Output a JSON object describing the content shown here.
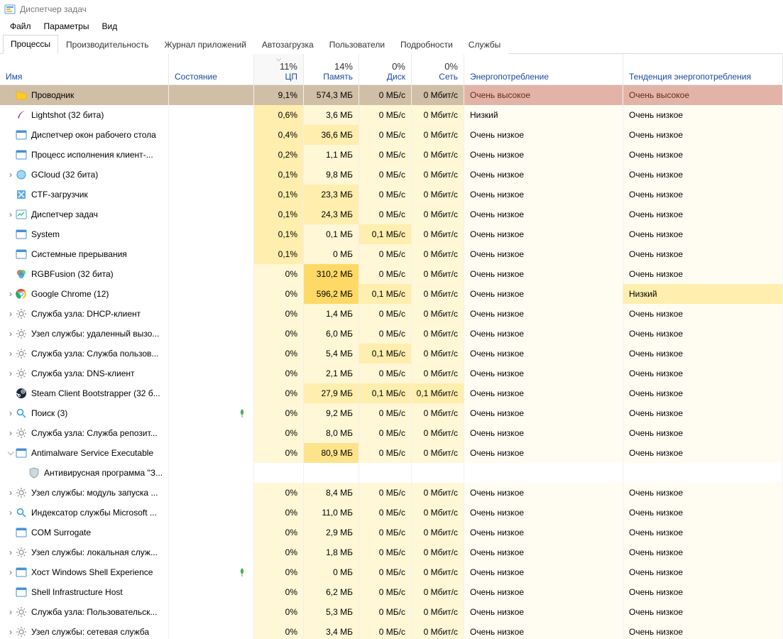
{
  "window": {
    "title": "Диспетчер задач"
  },
  "menu": {
    "file": "Файл",
    "options": "Параметры",
    "view": "Вид"
  },
  "tabs": [
    {
      "id": "processes",
      "label": "Процессы",
      "active": true
    },
    {
      "id": "performance",
      "label": "Производительность"
    },
    {
      "id": "app-history",
      "label": "Журнал приложений"
    },
    {
      "id": "startup",
      "label": "Автозагрузка"
    },
    {
      "id": "users",
      "label": "Пользователи"
    },
    {
      "id": "details",
      "label": "Подробности"
    },
    {
      "id": "services",
      "label": "Службы"
    }
  ],
  "columns": {
    "name": {
      "label": "Имя"
    },
    "status": {
      "label": "Состояние"
    },
    "cpu": {
      "label": "ЦП",
      "summary": "11%",
      "sorted": "desc"
    },
    "mem": {
      "label": "Память",
      "summary": "14%"
    },
    "disk": {
      "label": "Диск",
      "summary": "0%"
    },
    "net": {
      "label": "Сеть",
      "summary": "0%"
    },
    "power": {
      "label": "Энергопотребление"
    },
    "trend": {
      "label": "Тенденция энергопотребления"
    }
  },
  "processes": [
    {
      "name": "Проводник",
      "icon": "folder",
      "cpu": "9,1%",
      "mem": "574,3 МБ",
      "disk": "0 МБ/с",
      "net": "0 Мбит/с",
      "power": "Очень высокое",
      "trend": "Очень высокое",
      "selected": true,
      "cpuHeat": 3,
      "memHeat": 3
    },
    {
      "name": "Lightshot (32 бита)",
      "icon": "feather",
      "cpu": "0,6%",
      "mem": "3,6 МБ",
      "disk": "0 МБ/с",
      "net": "0 Мбит/с",
      "power": "Низкий",
      "trend": "Очень низкое",
      "cpuHeat": 1,
      "memHeat": 0
    },
    {
      "name": "Диспетчер окон рабочего стола",
      "icon": "winexe",
      "cpu": "0,4%",
      "mem": "36,6 МБ",
      "disk": "0 МБ/с",
      "net": "0 Мбит/с",
      "power": "Очень низкое",
      "trend": "Очень низкое",
      "cpuHeat": 1,
      "memHeat": 1
    },
    {
      "name": "Процесс исполнения клиент-...",
      "icon": "winexe",
      "cpu": "0,2%",
      "mem": "1,1 МБ",
      "disk": "0 МБ/с",
      "net": "0 Мбит/с",
      "power": "Очень низкое",
      "trend": "Очень низкое",
      "cpuHeat": 1,
      "memHeat": 0
    },
    {
      "name": "GCloud (32 бита)",
      "icon": "gcloud",
      "expand": ">",
      "cpu": "0,1%",
      "mem": "9,8 МБ",
      "disk": "0 МБ/с",
      "net": "0 Мбит/с",
      "power": "Очень низкое",
      "trend": "Очень низкое",
      "cpuHeat": 1,
      "memHeat": 0
    },
    {
      "name": "CTF-загрузчик",
      "icon": "ctf",
      "cpu": "0,1%",
      "mem": "23,3 МБ",
      "disk": "0 МБ/с",
      "net": "0 Мбит/с",
      "power": "Очень низкое",
      "trend": "Очень низкое",
      "cpuHeat": 1,
      "memHeat": 1
    },
    {
      "name": "Диспетчер задач",
      "icon": "taskmgr",
      "expand": ">",
      "cpu": "0,1%",
      "mem": "24,3 МБ",
      "disk": "0 МБ/с",
      "net": "0 Мбит/с",
      "power": "Очень низкое",
      "trend": "Очень низкое",
      "cpuHeat": 1,
      "memHeat": 1
    },
    {
      "name": "System",
      "icon": "winexe",
      "cpu": "0,1%",
      "mem": "0,1 МБ",
      "disk": "0,1 МБ/с",
      "net": "0 Мбит/с",
      "power": "Очень низкое",
      "trend": "Очень низкое",
      "cpuHeat": 1,
      "memHeat": 0,
      "diskHeat": 1
    },
    {
      "name": "Системные прерывания",
      "icon": "winexe",
      "cpu": "0,1%",
      "mem": "0 МБ",
      "disk": "0 МБ/с",
      "net": "0 Мбит/с",
      "power": "Очень низкое",
      "trend": "Очень низкое",
      "cpuHeat": 1,
      "memHeat": 0
    },
    {
      "name": "RGBFusion (32 бита)",
      "icon": "rgb",
      "cpu": "0%",
      "mem": "310,2 МБ",
      "disk": "0 МБ/с",
      "net": "0 Мбит/с",
      "power": "Очень низкое",
      "trend": "Очень низкое",
      "cpuHeat": 0,
      "memHeat": 3
    },
    {
      "name": "Google Chrome (12)",
      "icon": "chrome",
      "expand": ">",
      "cpu": "0%",
      "mem": "596,2 МБ",
      "disk": "0,1 МБ/с",
      "net": "0 Мбит/с",
      "power": "Очень низкое",
      "trend": "Низкий",
      "trendHeat": 1,
      "cpuHeat": 0,
      "memHeat": 3,
      "diskHeat": 1
    },
    {
      "name": "Служба узла: DHCP-клиент",
      "icon": "gear",
      "expand": ">",
      "cpu": "0%",
      "mem": "1,4 МБ",
      "disk": "0 МБ/с",
      "net": "0 Мбит/с",
      "power": "Очень низкое",
      "trend": "Очень низкое",
      "cpuHeat": 0,
      "memHeat": 0
    },
    {
      "name": "Узел службы: удаленный вызо...",
      "icon": "gear",
      "expand": ">",
      "cpu": "0%",
      "mem": "6,0 МБ",
      "disk": "0 МБ/с",
      "net": "0 Мбит/с",
      "power": "Очень низкое",
      "trend": "Очень низкое",
      "cpuHeat": 0,
      "memHeat": 0
    },
    {
      "name": "Служба узла: Служба пользов...",
      "icon": "gear",
      "expand": ">",
      "cpu": "0%",
      "mem": "5,4 МБ",
      "disk": "0,1 МБ/с",
      "net": "0 Мбит/с",
      "power": "Очень низкое",
      "trend": "Очень низкое",
      "cpuHeat": 0,
      "memHeat": 0,
      "diskHeat": 1
    },
    {
      "name": "Служба узла: DNS-клиент",
      "icon": "gear",
      "expand": ">",
      "cpu": "0%",
      "mem": "2,1 МБ",
      "disk": "0 МБ/с",
      "net": "0 Мбит/с",
      "power": "Очень низкое",
      "trend": "Очень низкое",
      "cpuHeat": 0,
      "memHeat": 0
    },
    {
      "name": "Steam Client Bootstrapper (32 б...",
      "icon": "steam",
      "cpu": "0%",
      "mem": "27,9 МБ",
      "disk": "0,1 МБ/с",
      "net": "0,1 Мбит/с",
      "power": "Очень низкое",
      "trend": "Очень низкое",
      "cpuHeat": 0,
      "memHeat": 1,
      "diskHeat": 1,
      "netHeat": 1
    },
    {
      "name": "Поиск (3)",
      "icon": "search",
      "expand": ">",
      "leaf": true,
      "cpu": "0%",
      "mem": "9,2 МБ",
      "disk": "0 МБ/с",
      "net": "0 Мбит/с",
      "power": "Очень низкое",
      "trend": "Очень низкое",
      "cpuHeat": 0,
      "memHeat": 0
    },
    {
      "name": "Служба узла: Служба репозит...",
      "icon": "gear",
      "expand": ">",
      "cpu": "0%",
      "mem": "8,0 МБ",
      "disk": "0 МБ/с",
      "net": "0 Мбит/с",
      "power": "Очень низкое",
      "trend": "Очень низкое",
      "cpuHeat": 0,
      "memHeat": 0
    },
    {
      "name": "Antimalware Service Executable",
      "icon": "winexe",
      "expand": "v",
      "cpu": "0%",
      "mem": "80,9 МБ",
      "disk": "0 МБ/с",
      "net": "0 Мбит/с",
      "power": "Очень низкое",
      "trend": "Очень низкое",
      "cpuHeat": 0,
      "memHeat": 2
    },
    {
      "name": "Антивирусная программа \"З...",
      "icon": "defender",
      "child": true
    },
    {
      "name": "Узел службы: модуль запуска ...",
      "icon": "gear",
      "expand": ">",
      "cpu": "0%",
      "mem": "8,4 МБ",
      "disk": "0 МБ/с",
      "net": "0 Мбит/с",
      "power": "Очень низкое",
      "trend": "Очень низкое",
      "cpuHeat": 0,
      "memHeat": 0
    },
    {
      "name": "Индексатор службы Microsoft ...",
      "icon": "search",
      "expand": ">",
      "cpu": "0%",
      "mem": "11,0 МБ",
      "disk": "0 МБ/с",
      "net": "0 Мбит/с",
      "power": "Очень низкое",
      "trend": "Очень низкое",
      "cpuHeat": 0,
      "memHeat": 0
    },
    {
      "name": "COM Surrogate",
      "icon": "winexe",
      "cpu": "0%",
      "mem": "2,9 МБ",
      "disk": "0 МБ/с",
      "net": "0 Мбит/с",
      "power": "Очень низкое",
      "trend": "Очень низкое",
      "cpuHeat": 0,
      "memHeat": 0
    },
    {
      "name": "Узел службы: локальная служ...",
      "icon": "gear",
      "expand": ">",
      "cpu": "0%",
      "mem": "1,8 МБ",
      "disk": "0 МБ/с",
      "net": "0 Мбит/с",
      "power": "Очень низкое",
      "trend": "Очень низкое",
      "cpuHeat": 0,
      "memHeat": 0
    },
    {
      "name": "Хост Windows Shell Experience",
      "icon": "winexe",
      "expand": ">",
      "leaf": true,
      "cpu": "0%",
      "mem": "0 МБ",
      "disk": "0 МБ/с",
      "net": "0 Мбит/с",
      "power": "Очень низкое",
      "trend": "Очень низкое",
      "cpuHeat": 0,
      "memHeat": 0
    },
    {
      "name": "Shell Infrastructure Host",
      "icon": "winexe",
      "cpu": "0%",
      "mem": "6,2 МБ",
      "disk": "0 МБ/с",
      "net": "0 Мбит/с",
      "power": "Очень низкое",
      "trend": "Очень низкое",
      "cpuHeat": 0,
      "memHeat": 0
    },
    {
      "name": "Служба узла: Пользовательск...",
      "icon": "gear",
      "expand": ">",
      "cpu": "0%",
      "mem": "5,3 МБ",
      "disk": "0 МБ/с",
      "net": "0 Мбит/с",
      "power": "Очень низкое",
      "trend": "Очень низкое",
      "cpuHeat": 0,
      "memHeat": 0
    },
    {
      "name": "Узел службы: сетевая служба",
      "icon": "gear",
      "expand": ">",
      "cpu": "0%",
      "mem": "3,4 МБ",
      "disk": "0 МБ/с",
      "net": "0 Мбит/с",
      "power": "Очень низкое",
      "trend": "Очень низкое",
      "cpuHeat": 0,
      "memHeat": 0
    }
  ]
}
